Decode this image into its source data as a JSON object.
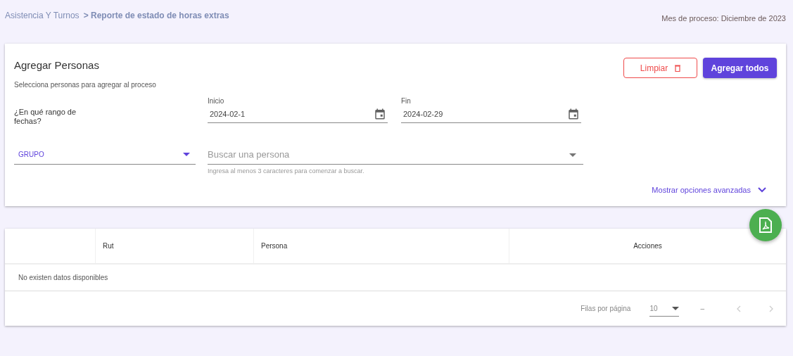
{
  "breadcrumb": {
    "items": [
      "Asistencia Y Turnos",
      "> Reporte de estado de horas extras"
    ]
  },
  "process_month": "Mes de proceso: Diciembre de 2023",
  "card": {
    "title": "Agregar Personas",
    "subtitle": "Selecciona personas para agregar al proceso",
    "buttons": [
      {
        "label": "Limpiar",
        "kind": "outline"
      },
      {
        "label": "Agregar todos",
        "kind": "primary"
      }
    ],
    "range_label": "¿En qué rango de fechas?",
    "start": {
      "label": "Inicio",
      "value": "2024-02-1"
    },
    "end": {
      "label": "Fin",
      "value": "2024-02-29"
    },
    "group": {
      "label": "GRUPO"
    },
    "search": {
      "placeholder": "Buscar una persona",
      "hint": "Ingresa al menos 3 caracteres para comenzar a buscar."
    },
    "advanced": "Mostrar opciones avanzadas"
  },
  "table": {
    "columns": [
      "",
      "Rut",
      "Persona",
      "Acciones"
    ],
    "empty": "No existen datos disponibles",
    "footer": {
      "rows_label": "Filas por página",
      "rows_value": "10",
      "range": "–"
    }
  }
}
